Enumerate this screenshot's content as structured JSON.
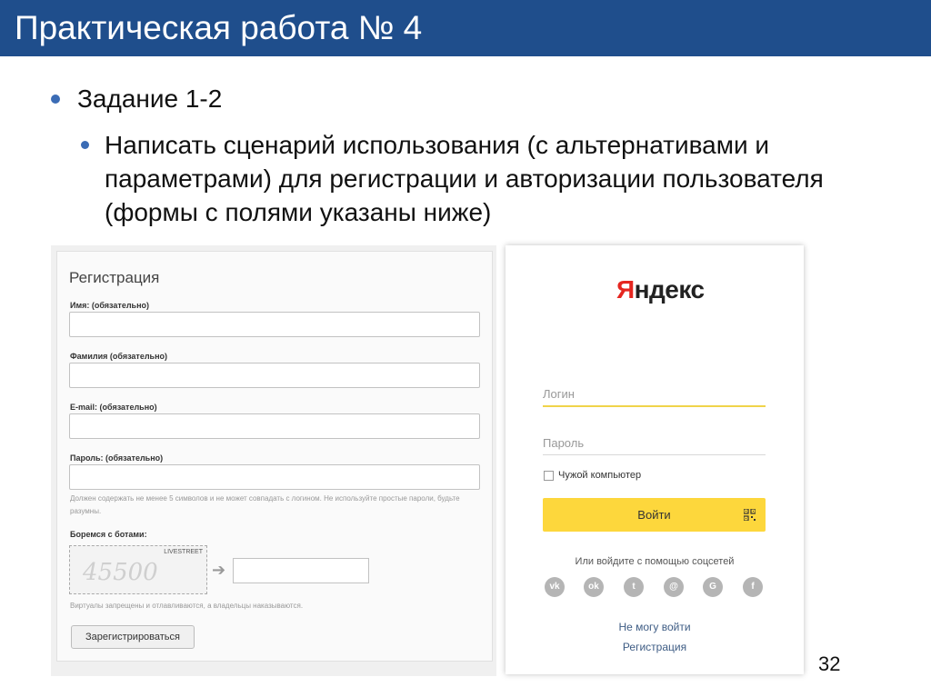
{
  "slide": {
    "title": "Практическая работа № 4",
    "task_heading": "Задание 1-2",
    "task_description": "Написать сценарий использования (с альтернативами и  параметрами) для регистрации и авторизации пользователя (формы с полями указаны ниже)",
    "page_number": "32"
  },
  "registration": {
    "title": "Регистрация",
    "fields": [
      {
        "label": "Имя: (обязательно)"
      },
      {
        "label": "Фамилия (обязательно)"
      },
      {
        "label": "E-mail: (обязательно)"
      },
      {
        "label": "Пароль: (обязательно)"
      }
    ],
    "password_hint": "Должен содержать не менее 5 символов и не может совпадать с логином. Не используйте простые пароли, будьте разумны.",
    "bots_label": "Боремся с ботами:",
    "captcha_brand": "LIVESTREET",
    "captcha_code": "45500",
    "bots_note": "Виртуалы запрещены и отлавливаются, а владельцы наказываются.",
    "submit_label": "Зарегистрироваться"
  },
  "yandex": {
    "logo_first": "Я",
    "logo_rest": "ндекс",
    "login_placeholder": "Логин",
    "password_placeholder": "Пароль",
    "foreign_computer_label": "Чужой компьютер",
    "login_button": "Войти",
    "social_label": "Или войдите с помощью соцсетей",
    "social_icons": [
      "vk-icon",
      "odnoklassniki-icon",
      "twitter-icon",
      "mail-icon",
      "google-icon",
      "facebook-icon"
    ],
    "cant_login_link": "Не могу войти",
    "register_link": "Регистрация",
    "colors": {
      "button": "#fdd73c",
      "logo_accent": "#e52620",
      "link": "#3e5c84"
    }
  },
  "theme": {
    "title_bar": "#1f4e8c",
    "bullet": "#3b6cb5"
  }
}
